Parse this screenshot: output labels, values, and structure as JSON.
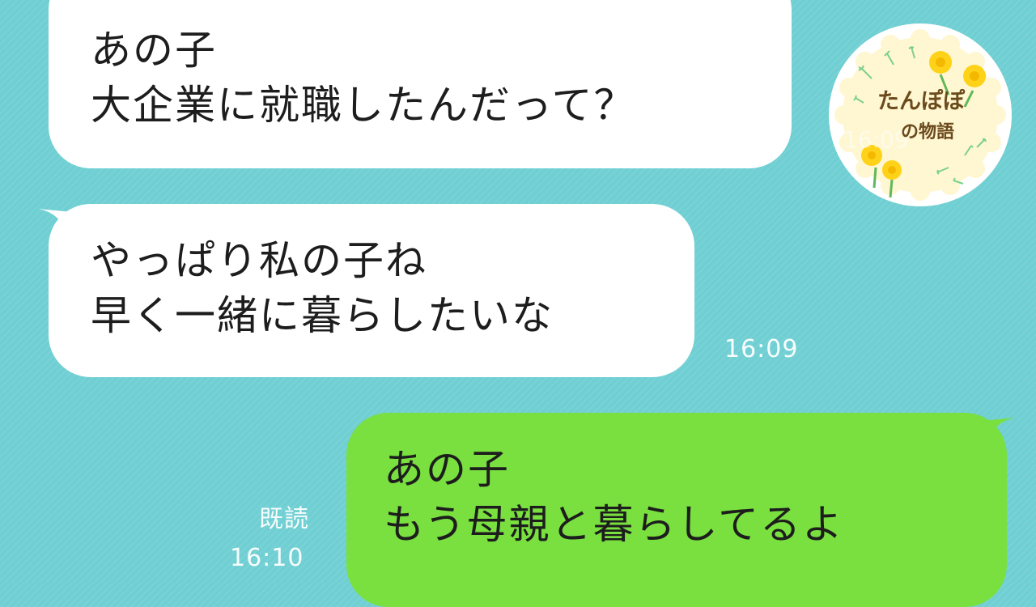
{
  "messages": [
    {
      "side": "left",
      "lines": [
        "あの子",
        "大企業に就職したんだって？"
      ]
    },
    {
      "side": "left",
      "lines": [
        "やっぱり私の子ね",
        "早く一緒に暮らしたいな"
      ],
      "time": "16:09"
    },
    {
      "side": "right",
      "lines": [
        "あの子",
        "もう母親と暮らしてるよ"
      ],
      "read_label": "既読",
      "time": "16:10"
    }
  ],
  "logo": {
    "line1": "たんぽぽ",
    "line2": "の物語",
    "watermark": "16:09"
  },
  "colors": {
    "background": "#6fcfd3",
    "incoming_bubble": "#ffffff",
    "outgoing_bubble": "#79e03f",
    "meta_text": "#ffffff",
    "logo_badge": "#fff7d1",
    "logo_text": "#6b4a1d",
    "flower": "#ffd21a"
  },
  "icons": [
    "dandelion-flower-icon",
    "dandelion-seed-icon"
  ]
}
